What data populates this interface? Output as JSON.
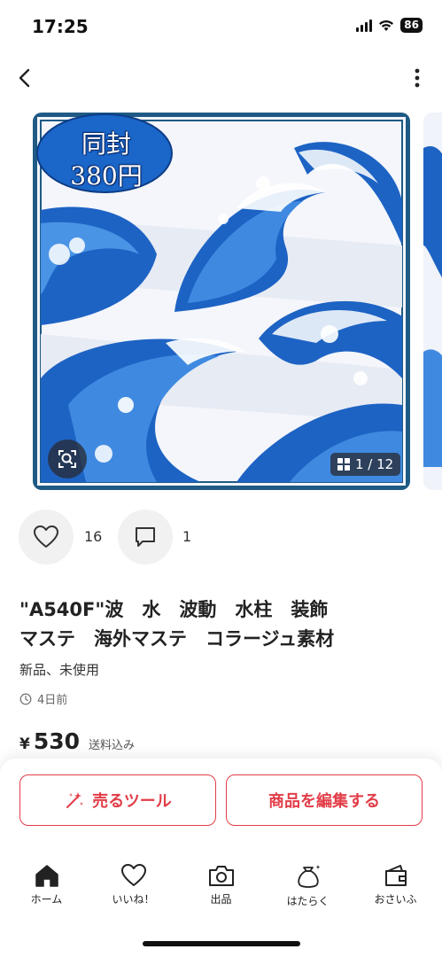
{
  "status": {
    "time": "17:25",
    "battery": "86"
  },
  "photo": {
    "stamp_line1": "同封",
    "stamp_line2": "380円",
    "counter": "1 / 12"
  },
  "actions": {
    "likes": "16",
    "comments": "1"
  },
  "item": {
    "title_line1": "\"A540F\"波　水　波動　水柱　装飾",
    "title_line2": "マステ　海外マステ　コラージュ素材",
    "condition": "新品、未使用",
    "posted": "4日前",
    "price_currency": "¥",
    "price": "530",
    "shipping": "送料込み"
  },
  "buttons": {
    "sell_tool": "売るツール",
    "edit_item": "商品を編集する"
  },
  "tabs": [
    {
      "label": "ホーム",
      "icon": "home-icon"
    },
    {
      "label": "いいね！",
      "icon": "heart-icon"
    },
    {
      "label": "出品",
      "icon": "camera-icon"
    },
    {
      "label": "はたらく",
      "icon": "money-bag-icon"
    },
    {
      "label": "おさいふ",
      "icon": "wallet-icon"
    }
  ],
  "colors": {
    "accent": "#e23d48",
    "photo_border": "#1f5a85",
    "wave_blue": "#1d63c4"
  }
}
